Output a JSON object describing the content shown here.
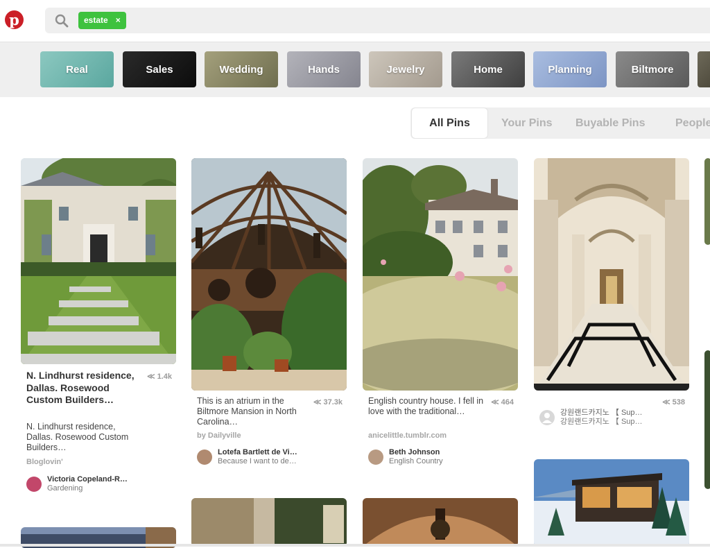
{
  "header": {
    "logo": "p",
    "search_chip": "estate",
    "search_chip_close": "×"
  },
  "guides": [
    {
      "label": "Real",
      "color": "#6bb5ad"
    },
    {
      "label": "Sales",
      "color": "#1e1e1e"
    },
    {
      "label": "Wedding",
      "color": "#8b8b63"
    },
    {
      "label": "Hands",
      "color": "#9a9aa3"
    },
    {
      "label": "Jewelry",
      "color": "#b5aea4"
    },
    {
      "label": "Home",
      "color": "#5c5c5c"
    },
    {
      "label": "Planning",
      "color": "#8fa6d0"
    },
    {
      "label": "Biltmore",
      "color": "#6f6f6f"
    }
  ],
  "tabs": [
    "All Pins",
    "Your Pins",
    "Buyable Pins",
    "People"
  ],
  "pins": {
    "p1": {
      "saves": "1.4k",
      "title": "N. Lindhurst residence, Dallas. Rosewood Custom Builders…",
      "desc": "N. Lindhurst residence, Dallas. Rosewood Custom Builders…",
      "domain": "Bloglovin'",
      "pinner_name": "Victoria Copeland-R…",
      "pinner_board": "Gardening"
    },
    "p2": {
      "saves": "37.3k",
      "desc": "This is an atrium in the Biltmore Mansion in North Carolina…",
      "domain": "by Dailyville",
      "pinner_name": "Lotefa Bartlett de Vi…",
      "pinner_board": "Because I want to de…"
    },
    "p3": {
      "saves": "464",
      "desc": "English country house. I fell in love with the traditional…",
      "domain": "anicelittle.tumblr.com",
      "pinner_name": "Beth Johnson",
      "pinner_board": "English Country"
    },
    "p4": {
      "saves": "538",
      "pinner_name": "강원랜드카지노 【 Sup…",
      "pinner_board": "강원랜드카지노 【 Sup…"
    }
  },
  "colors": {
    "brand": "#cb1f27",
    "chip": "#3ec23e"
  }
}
